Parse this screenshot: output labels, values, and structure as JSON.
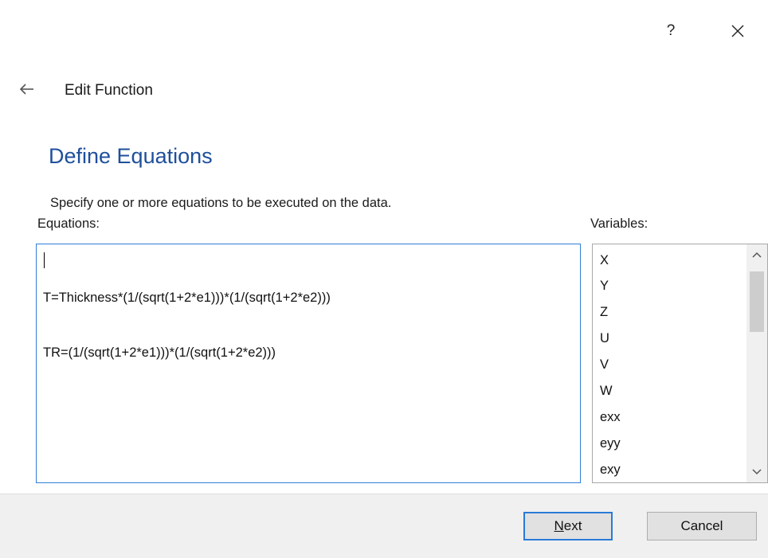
{
  "titlebar": {
    "help_label": "?",
    "close_icon": "close-icon"
  },
  "header": {
    "back_icon": "back-arrow-icon",
    "title": "Edit Function"
  },
  "section": {
    "title": "Define Equations",
    "description": "Specify one or more equations to be executed on the data."
  },
  "equations": {
    "label": "Equations:",
    "lines": [
      "T=Thickness*(1/(sqrt(1+2*e1)))*(1/(sqrt(1+2*e2)))",
      "TR=(1/(sqrt(1+2*e1)))*(1/(sqrt(1+2*e2)))"
    ]
  },
  "variables": {
    "label": "Variables:",
    "items": [
      "X",
      "Y",
      "Z",
      "U",
      "V",
      "W",
      "exx",
      "eyy",
      "exy"
    ]
  },
  "footer": {
    "next_mnemonic": "N",
    "next_rest": "ext",
    "cancel_label": "Cancel"
  },
  "colors": {
    "accent": "#2f7fd8",
    "section_title": "#1f4f9c",
    "footer_bg": "#f0f0f0"
  }
}
